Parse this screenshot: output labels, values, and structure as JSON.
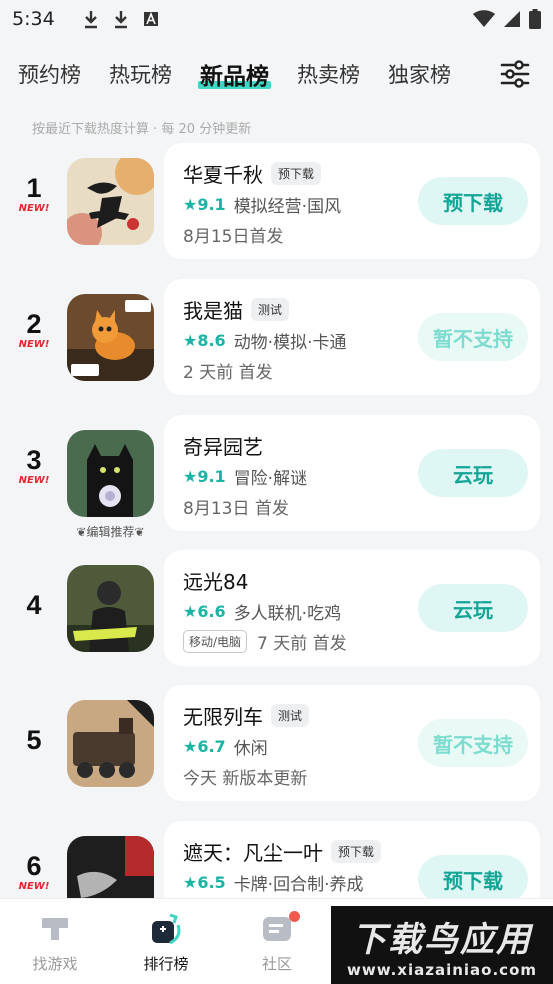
{
  "status_bar": {
    "time": "5:34"
  },
  "tabs": [
    {
      "label": "预约榜"
    },
    {
      "label": "热玩榜"
    },
    {
      "label": "新品榜"
    },
    {
      "label": "热卖榜"
    },
    {
      "label": "独家榜"
    }
  ],
  "active_tab": "新品榜",
  "note": "按最近下载热度计算 · 每 20 分钟更新",
  "colors": {
    "accent": "#3fd6c4",
    "rating": "#19b4a4",
    "new": "#e8242f",
    "button_bg": "#dff7f4"
  },
  "apps": [
    {
      "rank": "1",
      "new": "NEW!",
      "name": "华夏千秋",
      "badge": "预下载",
      "rating": "9.1",
      "tags": "模拟经营·国风",
      "date": "8月15日首发",
      "action": "预下载",
      "icon": "huaxia-icon"
    },
    {
      "rank": "2",
      "new": "NEW!",
      "name": "我是猫",
      "badge": "测试",
      "rating": "8.6",
      "tags": "动物·模拟·卡通",
      "date": "2 天前 首发",
      "action": "暂不支持",
      "icon": "cat-icon"
    },
    {
      "rank": "3",
      "new": "NEW!",
      "name": "奇异园艺",
      "rating": "9.1",
      "tags": "冒险·解谜",
      "date": "8月13日 首发",
      "action": "云玩",
      "editor_tag": "编辑推荐",
      "icon": "black-cat-icon"
    },
    {
      "rank": "4",
      "name": "远光84",
      "rating": "6.6",
      "tags": "多人联机·吃鸡",
      "platform": "移动/电脑",
      "date": "7 天前 首发",
      "action": "云玩",
      "icon": "soldier-icon"
    },
    {
      "rank": "5",
      "name": "无限列车",
      "badge": "测试",
      "rating": "6.7",
      "tags": "休闲",
      "date": "今天 新版本更新",
      "action": "暂不支持",
      "icon": "train-icon"
    },
    {
      "rank": "6",
      "new": "NEW!",
      "name": "遮天：凡尘一叶",
      "badge": "预下载",
      "rating": "6.5",
      "tags": "卡牌·回合制·养成",
      "action": "预下载",
      "icon": "zhetian-icon"
    }
  ],
  "bottom_nav": [
    {
      "label": "找游戏"
    },
    {
      "label": "排行榜"
    },
    {
      "label": "社区"
    }
  ],
  "watermark": {
    "main": "下载鸟应用",
    "sub": "www.xiazainiao.com"
  }
}
